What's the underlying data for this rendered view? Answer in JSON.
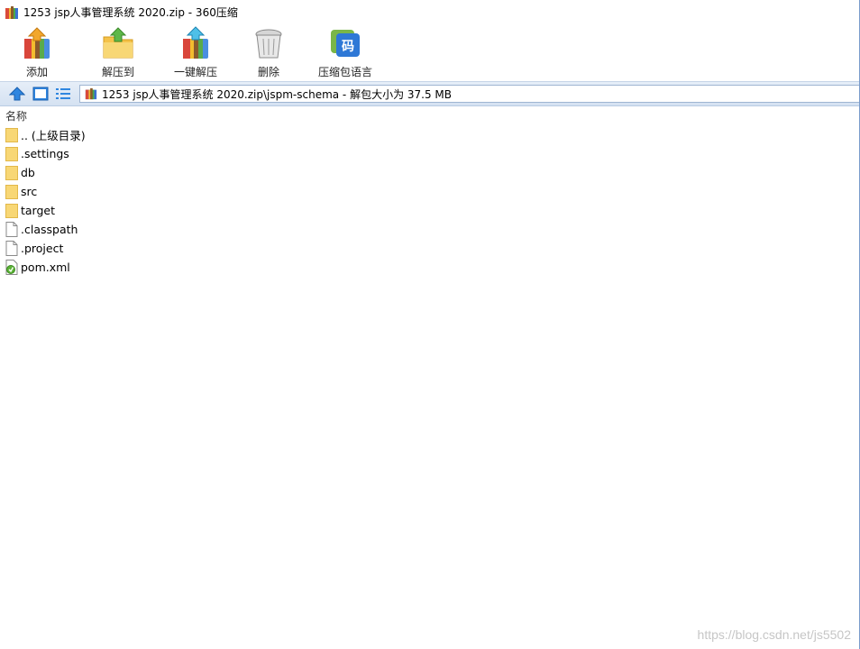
{
  "window": {
    "title": "1253 jsp人事管理系统 2020.zip - 360压缩"
  },
  "toolbar": {
    "items": [
      {
        "label": "添加",
        "icon": "add-icon"
      },
      {
        "label": "解压到",
        "icon": "extract-to-icon"
      },
      {
        "label": "一键解压",
        "icon": "one-click-extract-icon"
      },
      {
        "label": "删除",
        "icon": "trash-icon"
      },
      {
        "label": "压缩包语言",
        "icon": "archive-language-icon"
      }
    ]
  },
  "address": {
    "path": "1253 jsp人事管理系统 2020.zip\\jspm-schema - 解包大小为 37.5 MB"
  },
  "list": {
    "column_header": "名称",
    "rows": [
      {
        "name": ".. (上级目录)",
        "type": "folder"
      },
      {
        "name": ".settings",
        "type": "folder"
      },
      {
        "name": "db",
        "type": "folder"
      },
      {
        "name": "src",
        "type": "folder"
      },
      {
        "name": "target",
        "type": "folder"
      },
      {
        "name": ".classpath",
        "type": "file"
      },
      {
        "name": ".project",
        "type": "file"
      },
      {
        "name": "pom.xml",
        "type": "xml"
      }
    ]
  },
  "watermark": "https://blog.csdn.net/js5502",
  "colors": {
    "folder": "#f8d775",
    "accent": "#2a7be4",
    "addr_strip": "#dbe6f4"
  }
}
